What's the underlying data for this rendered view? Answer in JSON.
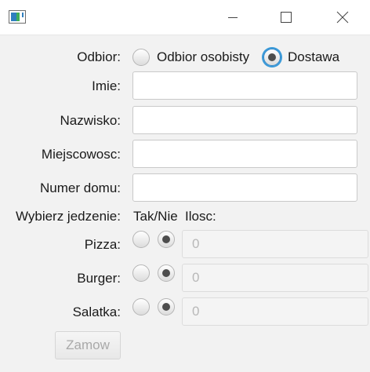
{
  "window": {
    "min_icon": "minimize-icon",
    "max_icon": "maximize-icon",
    "close_icon": "close-icon",
    "app_icon": "java-app-icon"
  },
  "form": {
    "pickup": {
      "label": "Odbior:",
      "options": [
        {
          "label": "Odbior osobisty",
          "selected": false
        },
        {
          "label": "Dostawa",
          "selected": true
        }
      ]
    },
    "fields": [
      {
        "label": "Imie:",
        "value": ""
      },
      {
        "label": "Nazwisko:",
        "value": ""
      },
      {
        "label": "Miejscowosc:",
        "value": ""
      },
      {
        "label": "Numer domu:",
        "value": ""
      }
    ],
    "food_header": {
      "label": "Wybierz jedzenie:",
      "yesno": "Tak/Nie",
      "qty": "Ilosc:"
    },
    "foods": [
      {
        "label": "Pizza:",
        "yes_selected": false,
        "no_selected": true,
        "qty_placeholder": "0"
      },
      {
        "label": "Burger:",
        "yes_selected": false,
        "no_selected": true,
        "qty_placeholder": "0"
      },
      {
        "label": "Salatka:",
        "yes_selected": false,
        "no_selected": true,
        "qty_placeholder": "0"
      }
    ],
    "submit_label": "Zamow"
  }
}
